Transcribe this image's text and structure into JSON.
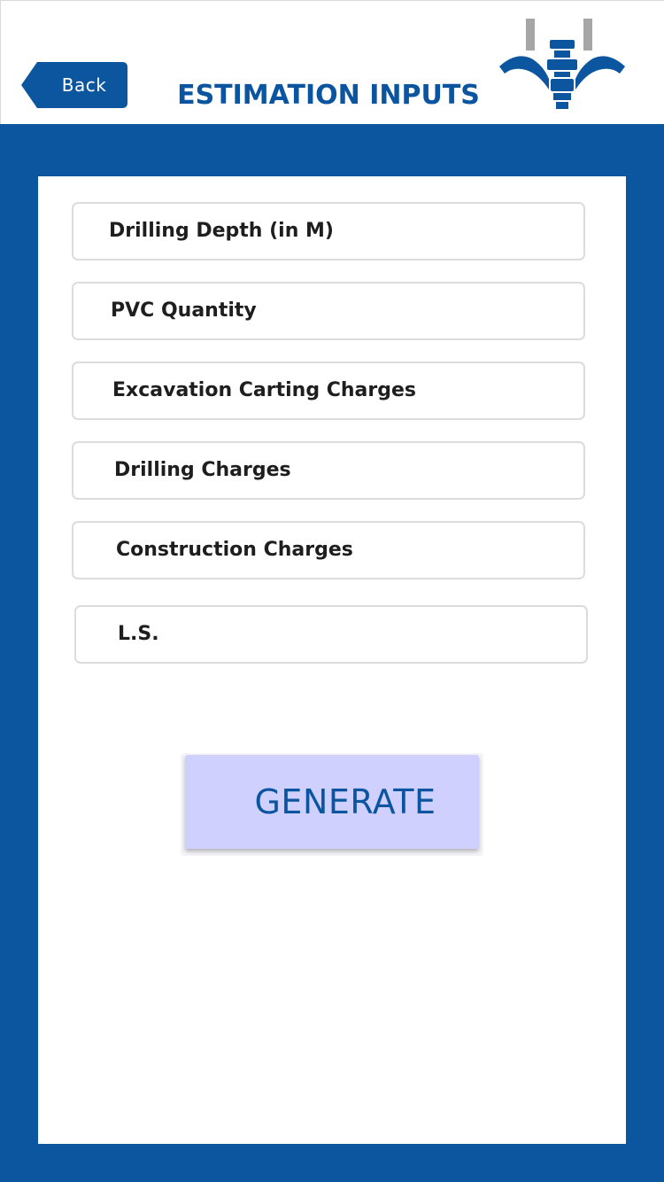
{
  "header": {
    "back_label": "Back",
    "title": "ESTIMATION INPUTS",
    "logo_icon": "drill-rig-logo-icon"
  },
  "form": {
    "fields": [
      {
        "label": "Drilling Depth (in M)"
      },
      {
        "label": "PVC Quantity"
      },
      {
        "label": "Excavation Carting Charges"
      },
      {
        "label": "Drilling Charges"
      },
      {
        "label": "Construction Charges"
      },
      {
        "label": "L.S."
      }
    ],
    "generate_label": "GENERATE"
  },
  "colors": {
    "brand_blue": "#0b569f",
    "button_fill": "#d0d0fe",
    "title_blue": "#0b55a0",
    "logo_gray": "#a6a6a6"
  }
}
